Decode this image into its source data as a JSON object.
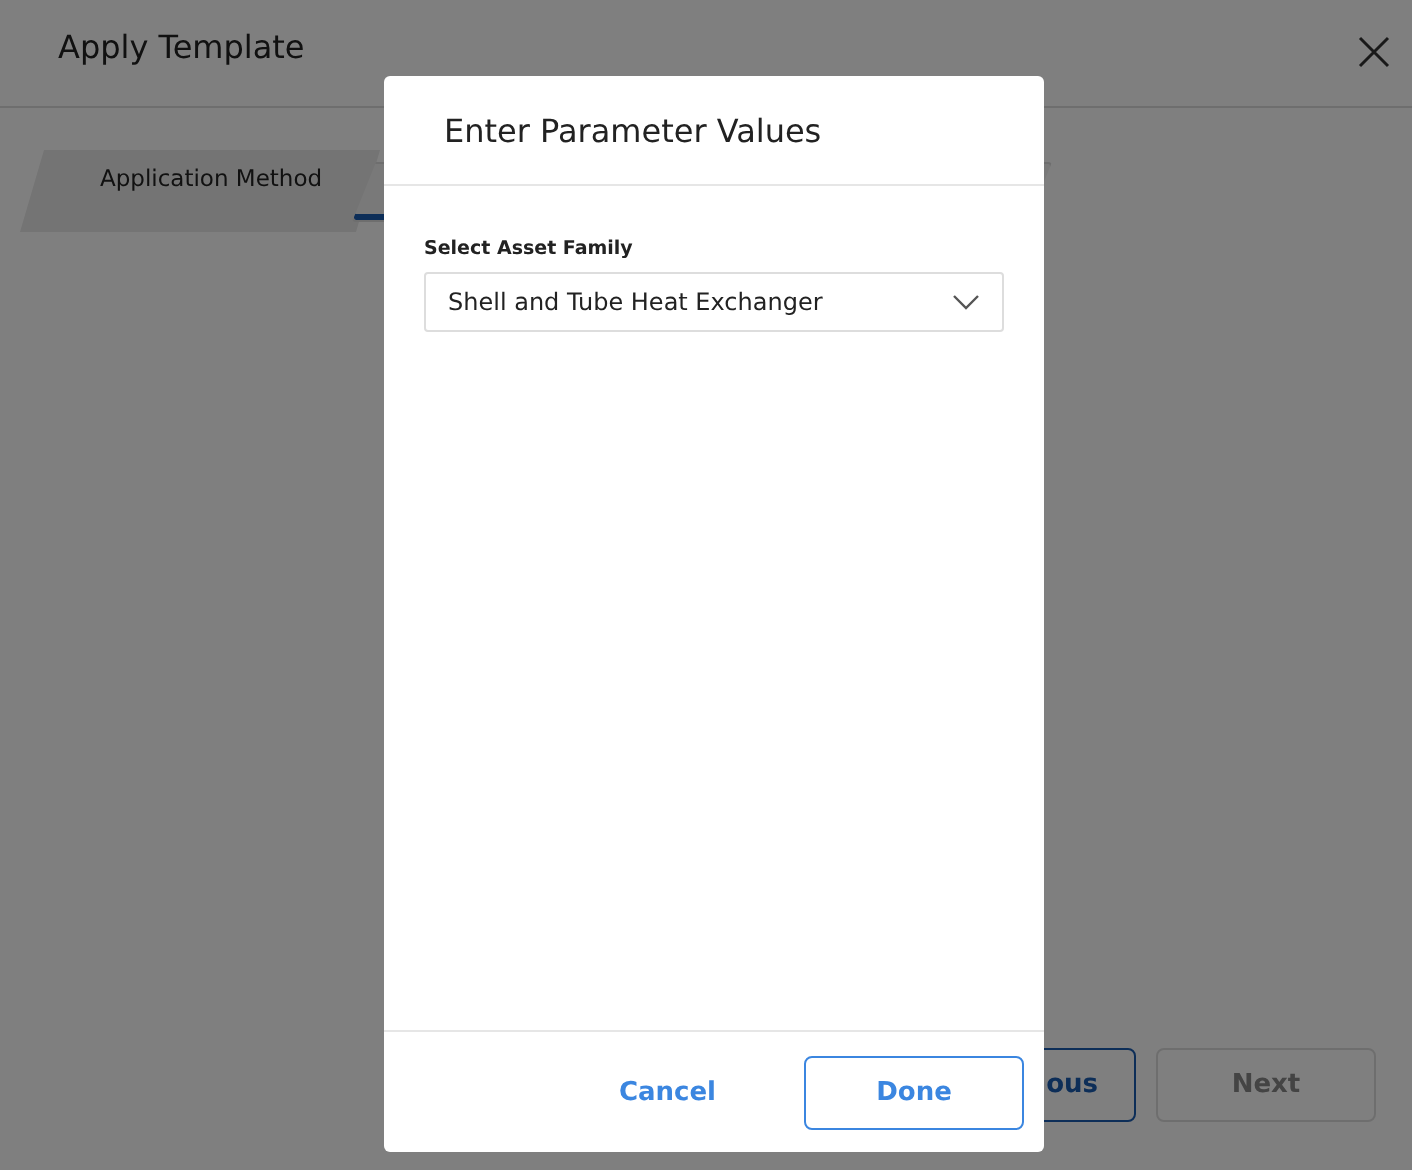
{
  "window": {
    "title": "Apply Template"
  },
  "tabs": [
    {
      "label": "Application Method",
      "selected": false
    },
    {
      "selected": true
    }
  ],
  "footer_buttons": [
    {
      "label": "ous",
      "kind": "secondary",
      "disabled": false
    },
    {
      "label": "Next",
      "kind": "primary",
      "disabled": true
    }
  ],
  "dialog": {
    "title": "Enter Parameter Values",
    "field_label": "Select Asset Family",
    "select_value": "Shell and Tube Heat Exchanger",
    "buttons": [
      {
        "label": "Cancel",
        "kind": "link"
      },
      {
        "label": "Done",
        "kind": "outline"
      }
    ]
  }
}
